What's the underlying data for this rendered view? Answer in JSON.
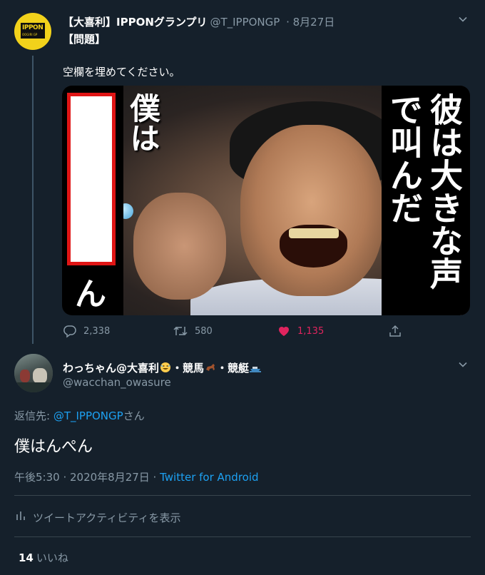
{
  "tweet1": {
    "name": "【大喜利】IPPONグランプリ",
    "handle": "@T_IPPONGP",
    "date": "· 8月27日",
    "line1": "【問題】",
    "line2": "空欄を埋めてください。",
    "media_text_left": "僕は",
    "media_text_n": "ん",
    "media_text_right": "彼は大きな声で叫んだ",
    "avatar_logo": "IPPON",
    "avatar_logo_sub": "OOGIRI GP",
    "reply_count": "2,338",
    "retweet_count": "580",
    "like_count": "1,135",
    "like_color": "#e0245e"
  },
  "tweet2": {
    "name": "わっちゃん@大喜利",
    "name_part2": "・競馬",
    "name_part3": "・競艇",
    "handle": "@wacchan_owasure",
    "reply_to_prefix": "返信先: ",
    "reply_to_handle": "@T_IPPONGP",
    "reply_to_suffix": "さん",
    "body": "僕はんぺん",
    "time": "午後5:30 · 2020年8月27日 · ",
    "client": "Twitter for Android",
    "activity_label": "ツイートアクティビティを表示",
    "likes_count": "14",
    "likes_label": "いいね"
  },
  "colors": {
    "background": "#15202b",
    "link": "#1da1f2",
    "muted": "#8899a6",
    "like": "#e0245e"
  },
  "icons": [
    "reply-icon",
    "retweet-icon",
    "like-icon",
    "share-icon",
    "chevron-down-icon",
    "bar-chart-icon"
  ]
}
